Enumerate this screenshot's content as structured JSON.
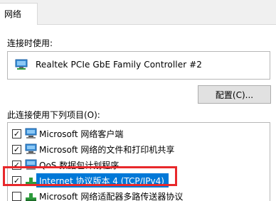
{
  "tab": {
    "label": "网络"
  },
  "connect": {
    "label": "连接时使用:",
    "adapter_name": "Realtek PCIe GbE Family Controller #2",
    "configure_label": "配置(C)..."
  },
  "items": {
    "label": "此连接使用下列项目(O):",
    "list": [
      {
        "checked": true,
        "text": "Microsoft 网络客户端",
        "icon": "network-client-icon"
      },
      {
        "checked": true,
        "text": "Microsoft 网络的文件和打印机共享",
        "icon": "file-share-icon"
      },
      {
        "checked": true,
        "text": "QoS 数据包计划程序",
        "icon": "qos-icon"
      },
      {
        "checked": true,
        "text": "Internet 协议版本 4 (TCP/IPv4)",
        "icon": "protocol-icon",
        "selected": true
      },
      {
        "checked": false,
        "text": "Microsoft 网络适配器多路传送器协议",
        "icon": "protocol-icon"
      }
    ]
  },
  "colors": {
    "selection": "#0078d7",
    "highlight_box": "#e8282b"
  }
}
